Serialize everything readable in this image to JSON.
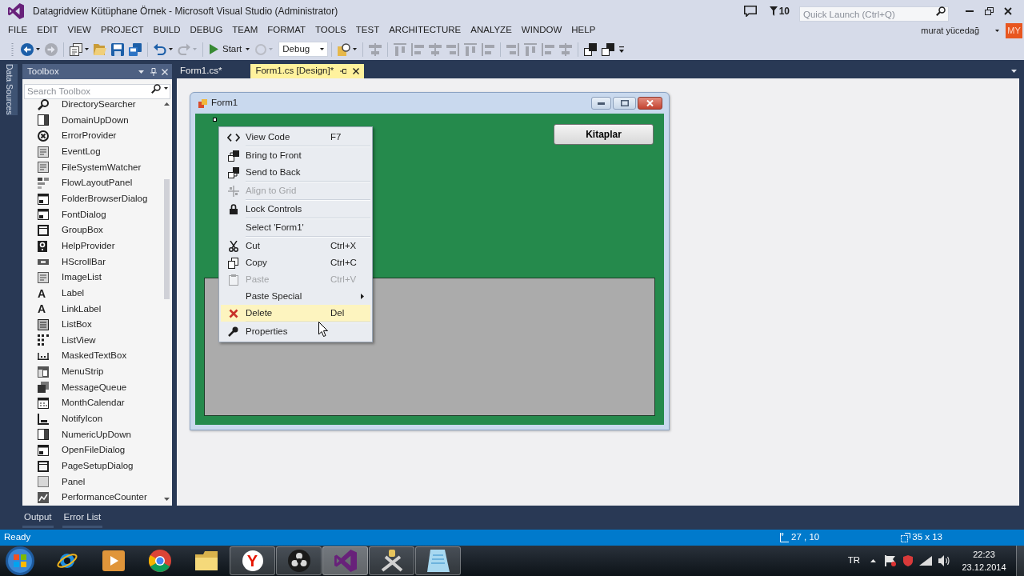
{
  "window": {
    "title": "Datagridview Kütüphane Örnek - Microsoft Visual Studio (Administrator)"
  },
  "title_bar": {
    "notification_count": "10",
    "quick_launch": {
      "placeholder": "Quick Launch (Ctrl+Q)"
    }
  },
  "menu_bar": [
    "FILE",
    "EDIT",
    "VIEW",
    "PROJECT",
    "BUILD",
    "DEBUG",
    "TEAM",
    "FORMAT",
    "TOOLS",
    "TEST",
    "ARCHITECTURE",
    "ANALYZE",
    "WINDOW",
    "HELP"
  ],
  "account": {
    "user": "murat yücedağ",
    "initials": "MY"
  },
  "toolbar": [
    {
      "kind": "button",
      "disabled": false,
      "has_menu": true
    },
    {
      "kind": "button",
      "disabled": true,
      "has_menu": false
    },
    {
      "kind": "separator"
    },
    {
      "kind": "button",
      "disabled": false,
      "has_menu": true
    },
    {
      "kind": "button",
      "disabled": false,
      "has_menu": false
    },
    {
      "kind": "button",
      "disabled": false,
      "has_menu": false
    },
    {
      "kind": "button",
      "disabled": false,
      "has_menu": false
    },
    {
      "kind": "separator"
    },
    {
      "kind": "button",
      "disabled": false,
      "has_menu": true
    },
    {
      "kind": "button",
      "disabled": true,
      "has_menu": true
    },
    {
      "kind": "separator"
    },
    {
      "kind": "start",
      "label": "Start",
      "has_menu": true
    },
    {
      "kind": "button",
      "disabled": true,
      "has_menu": true
    },
    {
      "kind": "combo",
      "value": "Debug"
    },
    {
      "kind": "separator"
    },
    {
      "kind": "button",
      "disabled": false,
      "has_menu": true
    },
    {
      "kind": "separator"
    },
    {
      "kind": "button",
      "disabled": true,
      "has_menu": false
    },
    {
      "kind": "separator"
    },
    {
      "kind": "button",
      "disabled": true,
      "has_menu": false
    },
    {
      "kind": "button",
      "disabled": true,
      "has_menu": false
    },
    {
      "kind": "button",
      "disabled": true,
      "has_menu": false
    },
    {
      "kind": "button",
      "disabled": true,
      "has_menu": false
    },
    {
      "kind": "button",
      "disabled": true,
      "has_menu": false
    },
    {
      "kind": "button",
      "disabled": true,
      "has_menu": false
    },
    {
      "kind": "separator"
    },
    {
      "kind": "button",
      "disabled": true,
      "has_menu": false
    },
    {
      "kind": "button",
      "disabled": true,
      "has_menu": false
    },
    {
      "kind": "button",
      "disabled": true,
      "has_menu": false
    },
    {
      "kind": "button",
      "disabled": true,
      "has_menu": false
    },
    {
      "kind": "separator"
    },
    {
      "kind": "button",
      "disabled": false,
      "has_menu": false
    },
    {
      "kind": "button",
      "disabled": false,
      "has_menu": false
    },
    {
      "kind": "button",
      "disabled": false,
      "has_menu": false
    }
  ],
  "side_tabs": [
    "Data Sources"
  ],
  "toolbox": {
    "title": "Toolbox",
    "search": {
      "placeholder": "Search Toolbox"
    },
    "items": [
      {
        "label": "DirectorySearcher"
      },
      {
        "label": "DomainUpDown"
      },
      {
        "label": "ErrorProvider"
      },
      {
        "label": "EventLog"
      },
      {
        "label": "FileSystemWatcher"
      },
      {
        "label": "FlowLayoutPanel"
      },
      {
        "label": "FolderBrowserDialog"
      },
      {
        "label": "FontDialog"
      },
      {
        "label": "GroupBox"
      },
      {
        "label": "HelpProvider"
      },
      {
        "label": "HScrollBar"
      },
      {
        "label": "ImageList"
      },
      {
        "label": "Label",
        "glyph": "A"
      },
      {
        "label": "LinkLabel",
        "glyph": "A"
      },
      {
        "label": "ListBox"
      },
      {
        "label": "ListView"
      },
      {
        "label": "MaskedTextBox"
      },
      {
        "label": "MenuStrip"
      },
      {
        "label": "MessageQueue"
      },
      {
        "label": "MonthCalendar"
      },
      {
        "label": "NotifyIcon"
      },
      {
        "label": "NumericUpDown"
      },
      {
        "label": "OpenFileDialog"
      },
      {
        "label": "PageSetupDialog"
      },
      {
        "label": "Panel"
      },
      {
        "label": "PerformanceCounter"
      }
    ]
  },
  "document_tabs": [
    {
      "label": "Form1.cs*",
      "selected": false
    },
    {
      "label": "Form1.cs [Design]*",
      "selected": true
    }
  ],
  "form": {
    "title": "Form1",
    "button": "Kitaplar"
  },
  "context_menu": {
    "groups": [
      [
        {
          "label": "View Code",
          "shortcut": "F7",
          "disabled": false,
          "selected": false,
          "has_submenu": false
        }
      ],
      [
        {
          "label": "Bring to Front",
          "disabled": false,
          "selected": false,
          "has_submenu": false
        },
        {
          "label": "Send to Back",
          "disabled": false,
          "selected": false,
          "has_submenu": false
        }
      ],
      [
        {
          "label": "Align to Grid",
          "disabled": true,
          "selected": false,
          "has_submenu": false
        }
      ],
      [
        {
          "label": "Lock Controls",
          "disabled": false,
          "selected": false,
          "has_submenu": false
        }
      ],
      [
        {
          "label": "Select 'Form1'",
          "disabled": false,
          "selected": false,
          "has_submenu": false
        }
      ],
      [
        {
          "label": "Cut",
          "shortcut": "Ctrl+X",
          "disabled": false,
          "selected": false,
          "has_submenu": false
        },
        {
          "label": "Copy",
          "shortcut": "Ctrl+C",
          "disabled": false,
          "selected": false,
          "has_submenu": false
        },
        {
          "label": "Paste",
          "shortcut": "Ctrl+V",
          "disabled": true,
          "selected": false,
          "has_submenu": false
        },
        {
          "label": "Paste Special",
          "disabled": false,
          "selected": false,
          "has_submenu": true
        },
        {
          "label": "Delete",
          "shortcut": "Del",
          "disabled": false,
          "selected": true,
          "has_submenu": false
        }
      ],
      [
        {
          "label": "Properties",
          "disabled": false,
          "selected": false,
          "has_submenu": false
        }
      ]
    ]
  },
  "bottom_tabs": [
    "Output",
    "Error List"
  ],
  "status_bar": {
    "text": "Ready",
    "position": "27 , 10",
    "size": "35 x 13"
  },
  "taskbar": {
    "apps": [
      {
        "running": false,
        "selected": false
      },
      {
        "running": false,
        "selected": false
      },
      {
        "running": false,
        "selected": false
      },
      {
        "running": false,
        "selected": false
      },
      {
        "running": true,
        "selected": false,
        "glyph": "Y"
      },
      {
        "running": true,
        "selected": false
      },
      {
        "running": true,
        "selected": true
      },
      {
        "running": true,
        "selected": false
      },
      {
        "running": true,
        "selected": false
      }
    ],
    "language": "TR",
    "time": "22:23",
    "date": "23.12.2014"
  }
}
